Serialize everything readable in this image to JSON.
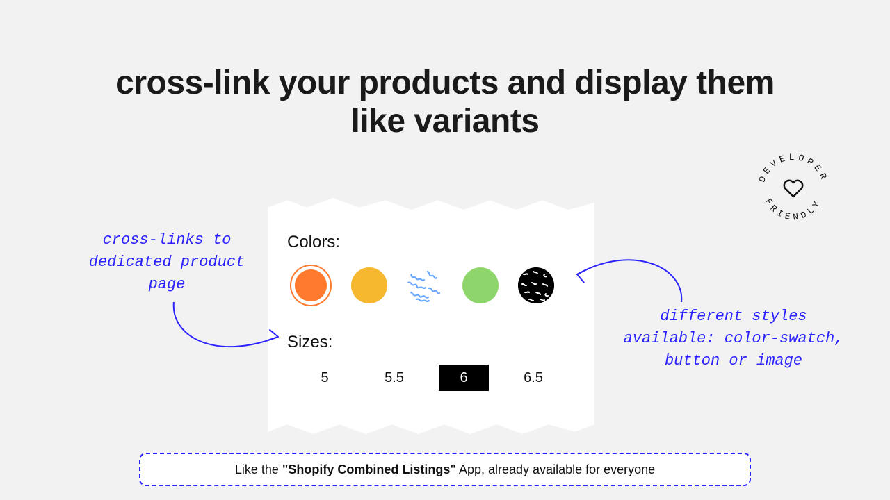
{
  "headline": "cross-link your products and display them like variants",
  "card": {
    "colors_label": "Colors:",
    "sizes_label": "Sizes:",
    "colors": [
      {
        "name": "orange",
        "selected": true
      },
      {
        "name": "yellow",
        "selected": false
      },
      {
        "name": "blue-pattern",
        "selected": false
      },
      {
        "name": "green",
        "selected": false
      },
      {
        "name": "black-pattern",
        "selected": false
      }
    ],
    "sizes": [
      {
        "label": "5",
        "selected": false
      },
      {
        "label": "5.5",
        "selected": false
      },
      {
        "label": "6",
        "selected": true
      },
      {
        "label": "6.5",
        "selected": false
      }
    ]
  },
  "annotations": {
    "left": "cross-links to dedicated product page",
    "right": "different styles available: color-swatch, button or image"
  },
  "badge": {
    "top_word": "DEVELOPER",
    "bottom_word": "FRIENDLY"
  },
  "footer": {
    "prefix": "Like the ",
    "bold": "\"Shopify Combined Listings\"",
    "suffix": " App, already available for everyone"
  }
}
